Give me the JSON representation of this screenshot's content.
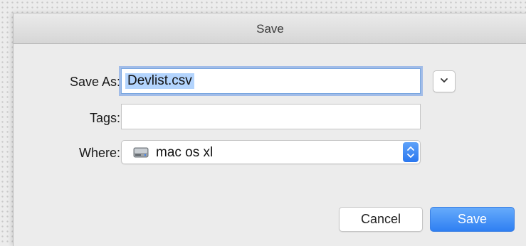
{
  "dialog": {
    "title": "Save"
  },
  "form": {
    "save_as_label": "Save As:",
    "save_as_value": "Devlist.csv",
    "tags_label": "Tags:",
    "tags_value": "",
    "where_label": "Where:",
    "where_value": "mac os xl",
    "where_icon": "hard-disk-icon",
    "expand_icon": "chevron-down-icon",
    "stepper_icon": "up-down-chevron-icon"
  },
  "buttons": {
    "cancel_label": "Cancel",
    "save_label": "Save"
  },
  "colors": {
    "accent": "#2f7ff2",
    "selection": "#b3d4fd"
  }
}
